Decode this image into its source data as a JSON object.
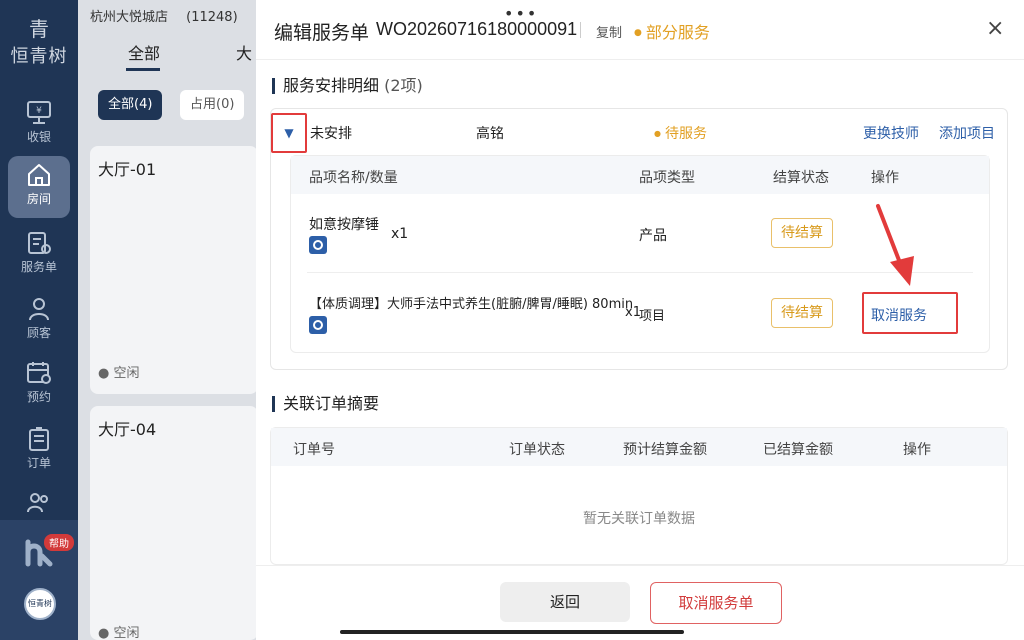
{
  "sidebar": {
    "logo_mark": "青",
    "logo_text": "恒青树",
    "items": [
      {
        "label": "收银",
        "icon": "cashier-icon"
      },
      {
        "label": "房间",
        "icon": "home-icon",
        "active": true
      },
      {
        "label": "服务单",
        "icon": "service-order-icon"
      },
      {
        "label": "顾客",
        "icon": "customer-icon"
      },
      {
        "label": "预约",
        "icon": "calendar-icon"
      },
      {
        "label": "订单",
        "icon": "order-icon"
      },
      {
        "label": "",
        "icon": "group-icon"
      }
    ],
    "help_badge": "帮助",
    "avatar_text": "恒青树"
  },
  "background": {
    "store_name": "杭州大悦城店",
    "store_code": "(11248)",
    "tabs": [
      "全部",
      "大"
    ],
    "filters": [
      "全部(4)",
      "占用(0)"
    ],
    "cards": [
      {
        "title": "大厅-01",
        "status": "空闲"
      },
      {
        "title": "大厅-04",
        "status": "空闲"
      }
    ]
  },
  "drawer": {
    "title": "编辑服务单",
    "order_no": "WO20260716180000091",
    "copy_label": "复制",
    "state": "部分服务",
    "close_icon": "×"
  },
  "service_section": {
    "title": "服务安排明细",
    "count": "(2项)",
    "group": {
      "expand_icon": "▼",
      "name": "未安排",
      "technician": "高铭",
      "state": "待服务",
      "change_tech": "更换技师",
      "add_item": "添加项目"
    },
    "headers": [
      "品项名称/数量",
      "品项类型",
      "结算状态",
      "操作"
    ],
    "rows": [
      {
        "name": "如意按摩锤",
        "qty": "x1",
        "type": "产品",
        "pay_status": "待结算",
        "action": ""
      },
      {
        "name": "【体质调理】大师手法中式养生(脏腑/脾胃/睡眠) 80min",
        "qty": "x1",
        "type": "项目",
        "pay_status": "待结算",
        "action": "取消服务"
      }
    ]
  },
  "related_section": {
    "title": "关联订单摘要",
    "headers": [
      "订单号",
      "订单状态",
      "预计结算金额",
      "已结算金额",
      "操作"
    ],
    "empty_text": "暂无关联订单数据"
  },
  "footer": {
    "back_label": "返回",
    "cancel_label": "取消服务单"
  },
  "colors": {
    "sidebar_bg": "#1f3555",
    "accent_blue": "#2d5fa8",
    "pending_orange": "#e2a023",
    "highlight_red": "#e23b3b"
  }
}
